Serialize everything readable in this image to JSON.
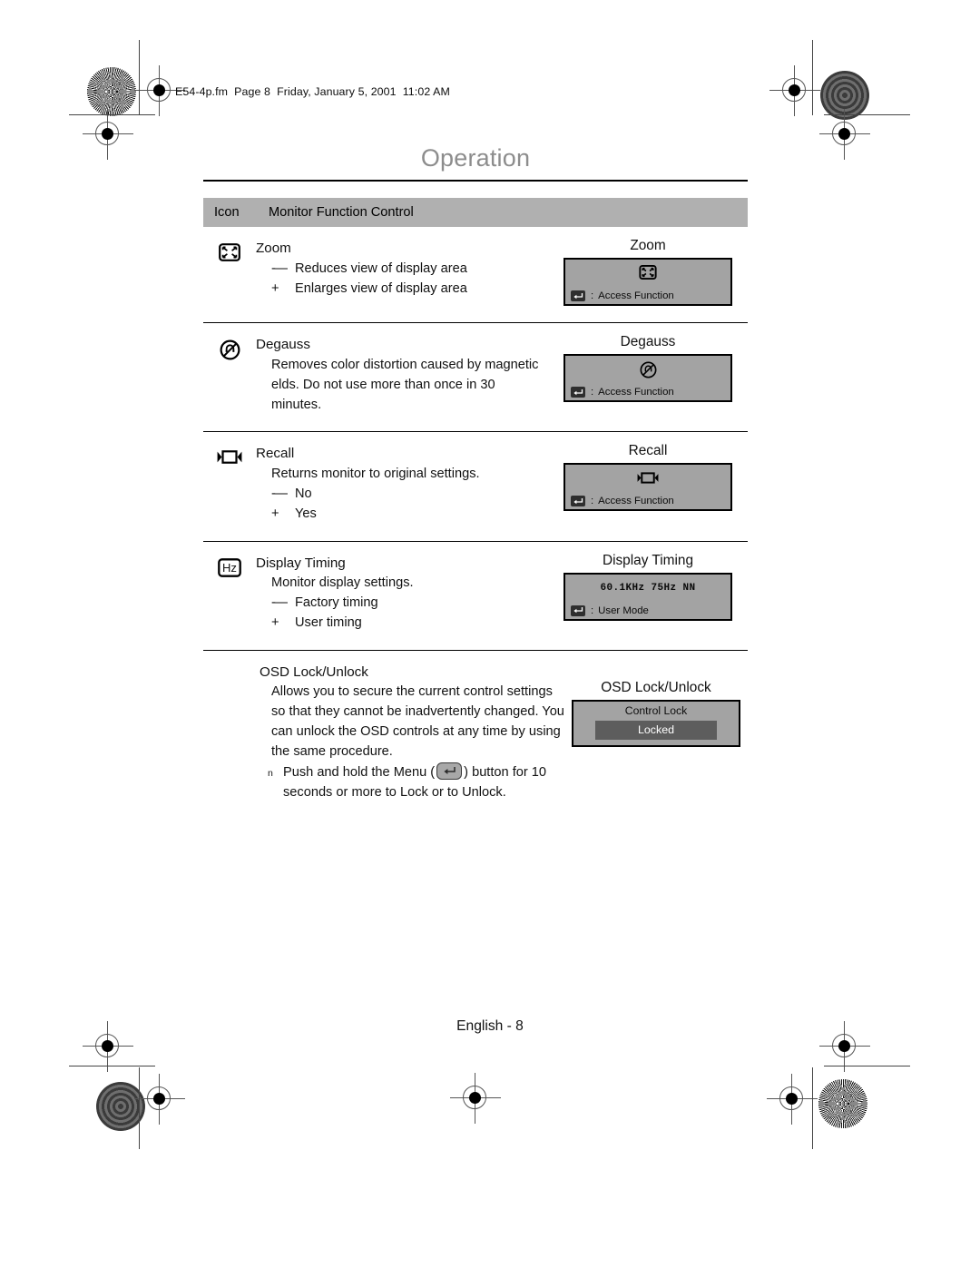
{
  "page": {
    "doc_header": "E54-4p.fm  Page 8  Friday, January 5, 2001  11:02 AM",
    "title": "Operation",
    "footer": "English -  8"
  },
  "table": {
    "header": {
      "icon_col": "Icon",
      "function_col": "Monitor Function Control"
    },
    "rows": [
      {
        "icon": "zoom-expand-icon",
        "name": "Zoom",
        "lines": [
          {
            "marker": "-—",
            "text": "Reduces view of display area"
          },
          {
            "marker": "+",
            "text": "Enlarges view of display area"
          }
        ],
        "osd": {
          "label": "Zoom",
          "glyph": "zoom-expand-icon",
          "foot_key": "enter-key-icon",
          "foot_sep": ":",
          "foot_text": "Access Function"
        }
      },
      {
        "icon": "degauss-icon",
        "name": "Degauss",
        "desc": "Removes color distortion caused by magnetic  elds. Do not use more than once in 30 minutes.",
        "osd": {
          "label": "Degauss",
          "glyph": "degauss-icon",
          "foot_key": "enter-key-icon",
          "foot_sep": ":",
          "foot_text": "Access Function"
        }
      },
      {
        "icon": "recall-icon",
        "name": "Recall",
        "desc": "Returns monitor to original settings.",
        "lines": [
          {
            "marker": "-—",
            "text": "No"
          },
          {
            "marker": "+",
            "text": "Yes"
          }
        ],
        "osd": {
          "label": "Recall",
          "glyph": "recall-icon",
          "foot_key": "enter-key-icon",
          "foot_sep": ":",
          "foot_text": "Access Function"
        }
      },
      {
        "icon": "hz-icon",
        "icon_text": "Hz",
        "name": "Display Timing",
        "desc": "Monitor display settings.",
        "lines": [
          {
            "marker": "-—",
            "text": "Factory timing"
          },
          {
            "marker": "+",
            "text": "User timing"
          }
        ],
        "osd": {
          "label": "Display Timing",
          "timing": "60.1KHz  75Hz  NN",
          "foot_key": "enter-key-icon",
          "foot_sep": ":",
          "foot_text": "User Mode"
        }
      },
      {
        "icon": null,
        "name": "OSD Lock/Unlock",
        "desc": "Allows you to secure the current control settings so that they cannot be inadvertently changed. You can unlock the OSD controls at any time by using the same procedure.",
        "note": {
          "marker": "n",
          "before": "Push and hold the Menu (",
          "key": "menu-key-icon",
          "after": ")",
          "rest": "button for 10 seconds or more to Lock or to Unlock."
        },
        "osd": {
          "label": "OSD Lock/Unlock",
          "lock_title": "Control Lock",
          "lock_state": "Locked"
        }
      }
    ]
  },
  "colors": {
    "title_gray": "#8d8d8d",
    "header_band": "#b0b0b0",
    "osd_bg": "#a3a3a3",
    "osd_bar": "#5d5d5d"
  }
}
